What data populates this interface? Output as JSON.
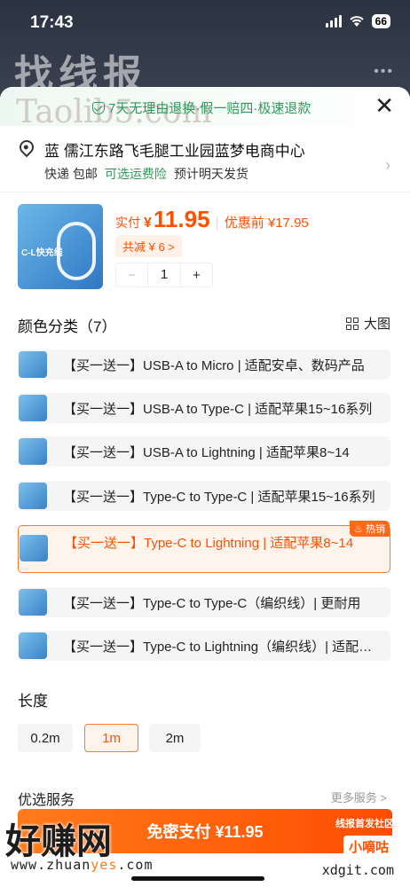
{
  "status": {
    "time": "17:43",
    "battery": "66"
  },
  "watermarks": {
    "top_logo": "找线报",
    "taolib": "Taolib5.com",
    "bottom_logo": "好赚网",
    "bottom_url_pre": "www.zhuan",
    "bottom_url_hl": "yes",
    "bottom_url_post": ".com",
    "right_top": "线报首发社区",
    "right_box": "小嘀咕",
    "right_url": "xdgit.com"
  },
  "guarantee": {
    "text": "7天无理由退换·假一赔四·极速退款"
  },
  "address": {
    "line": "蓝  儒江东路飞毛腿工业园蓝梦电商中心",
    "delivery": [
      "快递 包邮",
      "可选运费险",
      "预计明天发货"
    ]
  },
  "product": {
    "thumb_label": "C-L快充线",
    "price_label": "实付",
    "price_symbol": "¥",
    "price": "11.95",
    "orig_price": "优惠前 ¥17.95",
    "discount": "共减 ¥ 6 >",
    "quantity": "1",
    "minus": "−",
    "plus": "+"
  },
  "color_section": {
    "title": "颜色分类（7）",
    "big_view": "大图",
    "options": [
      {
        "label": "【买一送一】USB-A to Micro | 适配安卓、数码产品",
        "selected": false
      },
      {
        "label": "【买一送一】USB-A to Type-C | 适配苹果15~16系列",
        "selected": false
      },
      {
        "label": "【买一送一】USB-A to Lightning | 适配苹果8~14",
        "selected": false
      },
      {
        "label": "【买一送一】Type-C to Type-C | 适配苹果15~16系列",
        "selected": false
      },
      {
        "label": "【买一送一】Type-C to Lightning | 适配苹果8~14",
        "selected": true,
        "badge": "热销"
      },
      {
        "label": "【买一送一】Type-C to Type-C（编织线）| 更耐用",
        "selected": false
      },
      {
        "label": "【买一送一】Type-C to Lightning（编织线）| 适配苹果",
        "selected": false
      }
    ]
  },
  "length_section": {
    "title": "长度",
    "options": [
      {
        "label": "0.2m",
        "selected": false
      },
      {
        "label": "1m",
        "selected": true
      },
      {
        "label": "2m",
        "selected": false
      }
    ]
  },
  "services": {
    "title": "优选服务",
    "more": "更多服务 >"
  },
  "pay_button": {
    "label": "免密支付 ¥11.95"
  },
  "colors": {
    "accent": "#ff5000",
    "green": "#2f9a5a"
  }
}
